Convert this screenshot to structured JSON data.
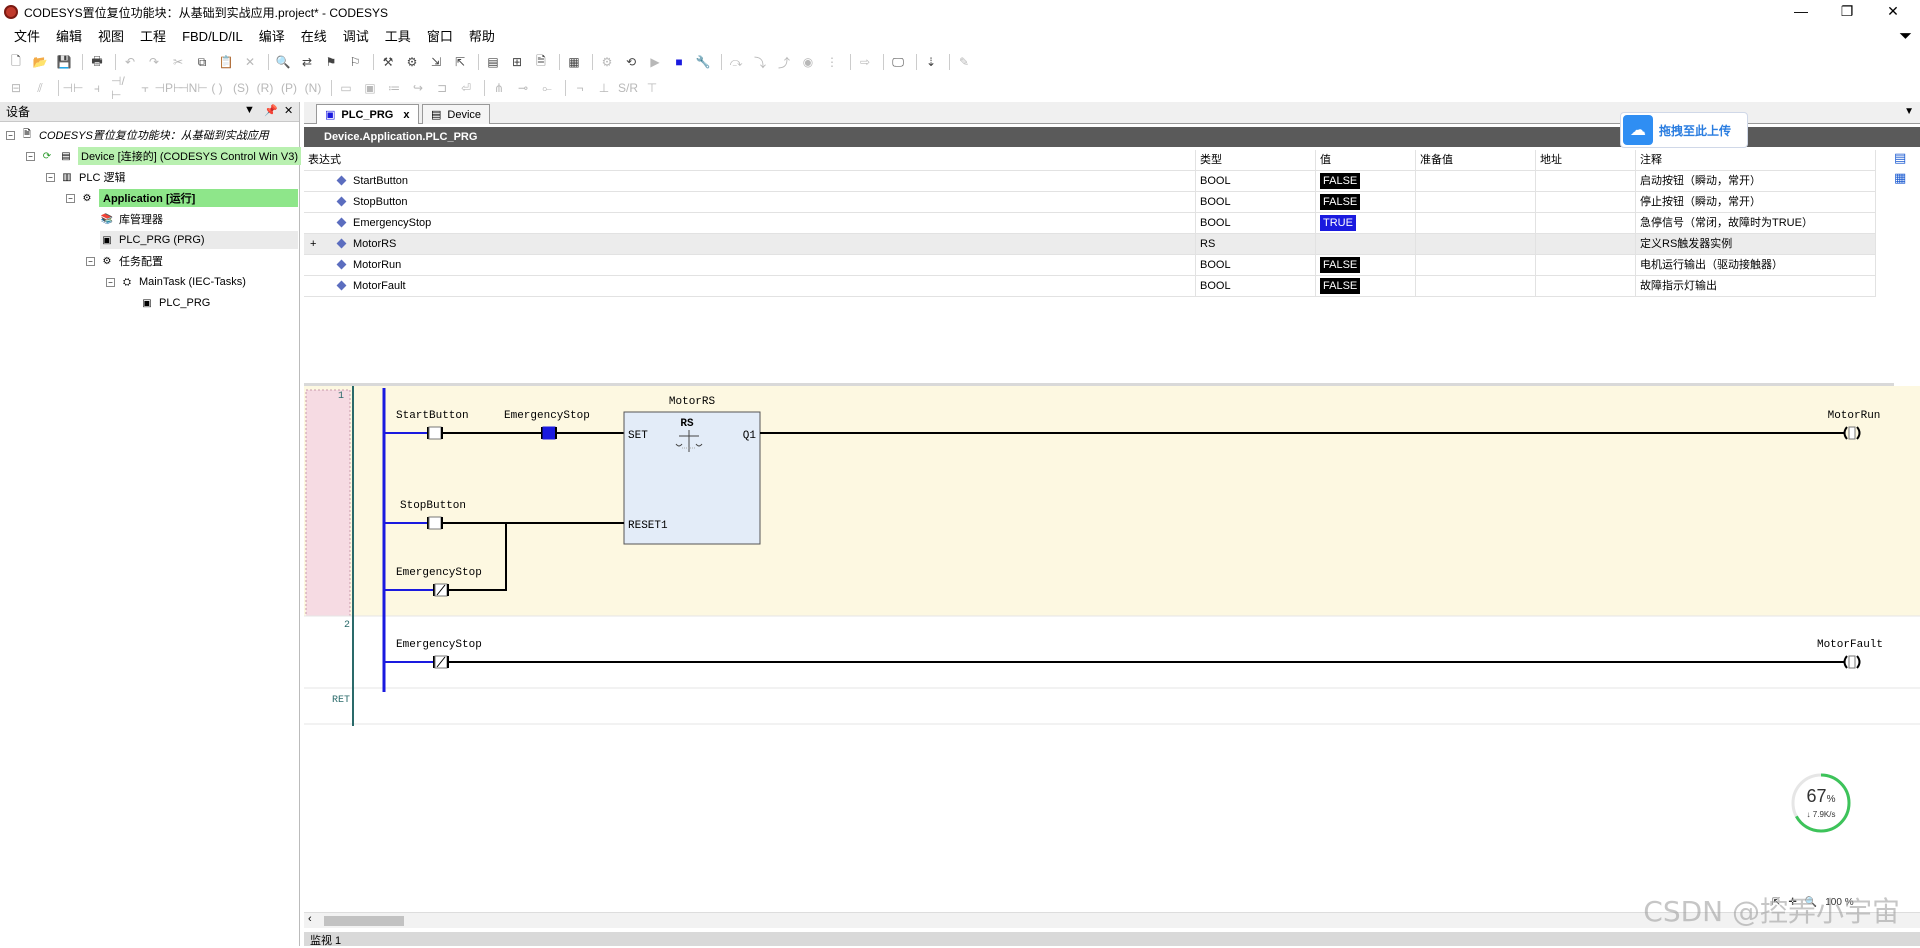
{
  "window": {
    "title": "CODESYS置位复位功能块：从基础到实战应用.project* - CODESYS",
    "minimize": "—",
    "restore": "❐",
    "close": "✕"
  },
  "menu": [
    "文件",
    "编辑",
    "视图",
    "工程",
    "FBD/LD/IL",
    "编译",
    "在线",
    "调试",
    "工具",
    "窗口",
    "帮助"
  ],
  "devices_panel": {
    "title": "设备",
    "tree": [
      {
        "label": "CODESYS置位复位功能块：从基础到实战应用",
        "italic": true
      },
      {
        "label": "Device [连接的] (CODESYS Control Win V3)"
      },
      {
        "label": "PLC 逻辑"
      },
      {
        "label": "Application [运行]"
      },
      {
        "label": "库管理器"
      },
      {
        "label": "PLC_PRG (PRG)"
      },
      {
        "label": "任务配置"
      },
      {
        "label": "MainTask (IEC-Tasks)"
      },
      {
        "label": "PLC_PRG"
      }
    ]
  },
  "tabs": [
    {
      "label": "PLC_PRG",
      "active": true,
      "close": "x"
    },
    {
      "label": "Device",
      "active": false
    }
  ],
  "path": "Device.Application.PLC_PRG",
  "upload_label": "拖拽至此上传",
  "vartable": {
    "headers": {
      "expr": "表达式",
      "type": "类型",
      "value": "值",
      "prepared": "准备值",
      "address": "地址",
      "comment": "注释"
    },
    "rows": [
      {
        "name": "StartButton",
        "type": "BOOL",
        "value": "FALSE",
        "comment": "启动按钮（瞬动，常开）"
      },
      {
        "name": "StopButton",
        "type": "BOOL",
        "value": "FALSE",
        "comment": "停止按钮（瞬动，常开）"
      },
      {
        "name": "EmergencyStop",
        "type": "BOOL",
        "value": "TRUE",
        "comment": "急停信号（常闭，故障时为TRUE）"
      },
      {
        "name": "MotorRS",
        "type": "RS",
        "value": "",
        "comment": "定义RS触发器实例",
        "expand": "+"
      },
      {
        "name": "MotorRun",
        "type": "BOOL",
        "value": "FALSE",
        "comment": "电机运行输出（驱动接触器）"
      },
      {
        "name": "MotorFault",
        "type": "BOOL",
        "value": "FALSE",
        "comment": "故障指示灯输出"
      }
    ]
  },
  "ladder": {
    "net1_no": "1",
    "net2_no": "2",
    "ret": "RET",
    "fb_instance": "MotorRS",
    "fb_type": "RS",
    "fb_in_set": "SET",
    "fb_in_reset": "RESET1",
    "fb_out": "Q1",
    "c_start": "StartButton",
    "c_estop1": "EmergencyStop",
    "c_stop": "StopButton",
    "c_estop2": "EmergencyStop",
    "coil1": "MotorRun",
    "c_estop3": "EmergencyStop",
    "coil2": "MotorFault"
  },
  "speed": {
    "percent": "67",
    "unit": "%",
    "rate": "↓ 7.9K/s",
    "value": 0.67
  },
  "zoom_text": "100 %",
  "watermark": "CSDN @控弄小宇宙",
  "status_left": "监视 1"
}
